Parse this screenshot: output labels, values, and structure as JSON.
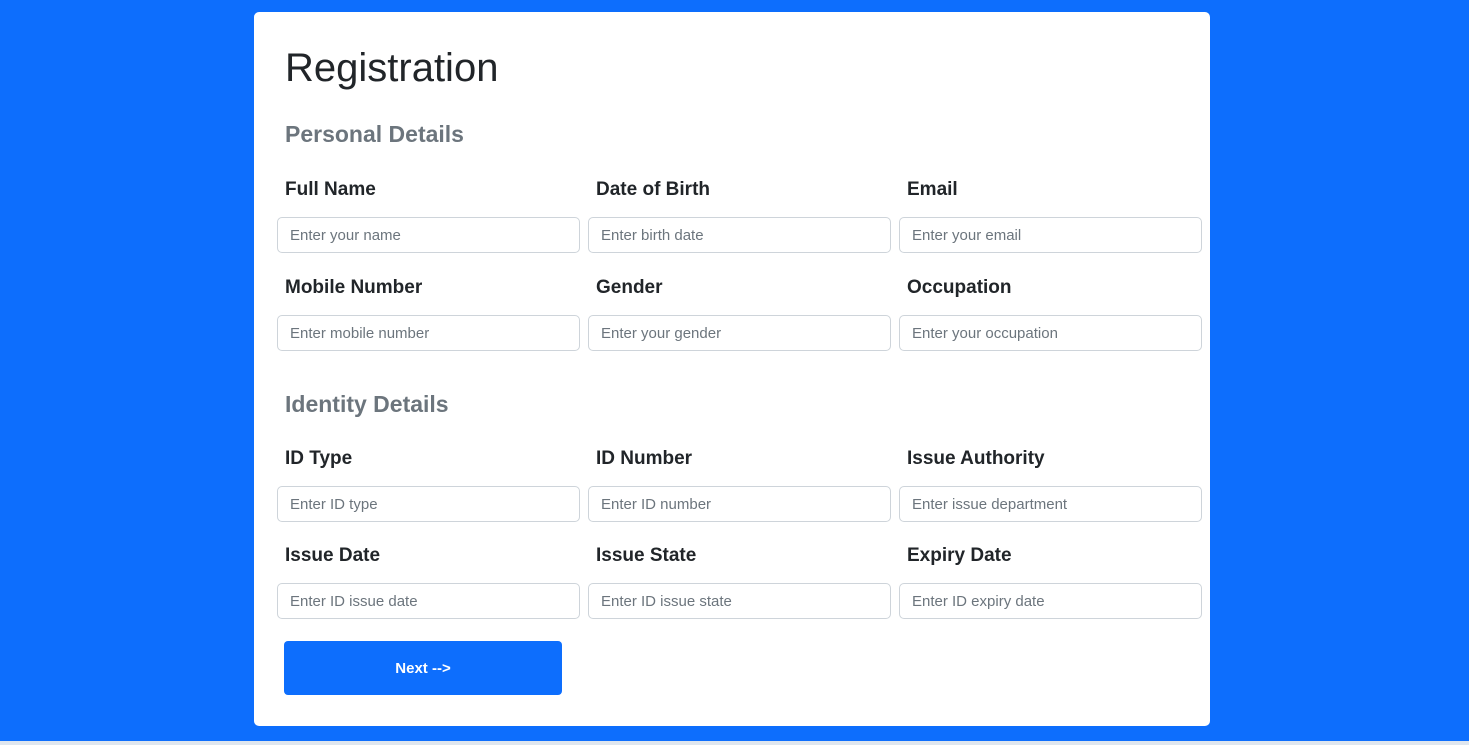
{
  "form": {
    "title": "Registration",
    "personal_section": {
      "title": "Personal Details",
      "fields": [
        {
          "label": "Full Name",
          "placeholder": "Enter your name"
        },
        {
          "label": "Date of Birth",
          "placeholder": "Enter birth date"
        },
        {
          "label": "Email",
          "placeholder": "Enter your email"
        },
        {
          "label": "Mobile Number",
          "placeholder": "Enter mobile number"
        },
        {
          "label": "Gender",
          "placeholder": "Enter your gender"
        },
        {
          "label": "Occupation",
          "placeholder": "Enter your occupation"
        }
      ]
    },
    "identity_section": {
      "title": "Identity Details",
      "fields": [
        {
          "label": "ID Type",
          "placeholder": "Enter ID type"
        },
        {
          "label": "ID Number",
          "placeholder": "Enter ID number"
        },
        {
          "label": "Issue Authority",
          "placeholder": "Enter issue department"
        },
        {
          "label": "Issue Date",
          "placeholder": "Enter ID issue date"
        },
        {
          "label": "Issue State",
          "placeholder": "Enter ID issue state"
        },
        {
          "label": "Expiry Date",
          "placeholder": "Enter ID expiry date"
        }
      ]
    },
    "next_label": "Next -->"
  },
  "colors": {
    "background": "#0d6efd",
    "card": "#ffffff",
    "accent": "#0d6efd",
    "section_title": "#6c757d",
    "input_border": "#ced4da"
  }
}
